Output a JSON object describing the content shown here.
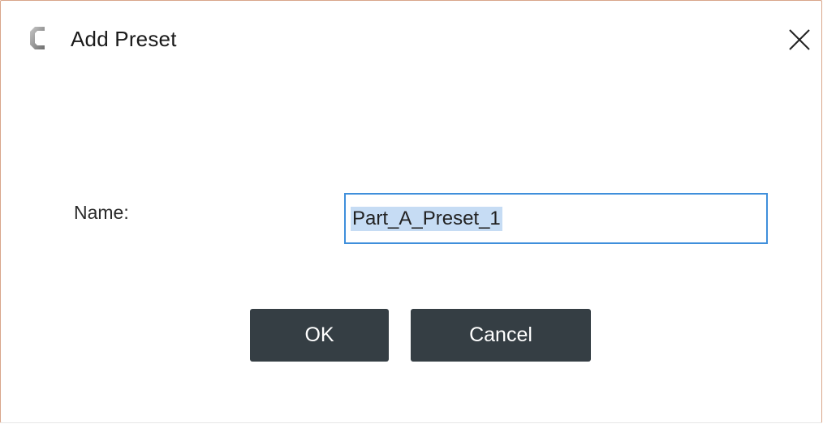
{
  "dialog": {
    "title": "Add Preset",
    "app_icon": "crescent-logo-icon",
    "close_icon": "close-icon"
  },
  "form": {
    "name_label": "Name:",
    "name_value": "Part_A_Preset_1",
    "name_selected": true
  },
  "buttons": {
    "ok_label": "OK",
    "cancel_label": "Cancel"
  },
  "colors": {
    "button_bg": "#353e44",
    "input_focus_border": "#3f8fdb",
    "selection_highlight": "#c6dcf4",
    "window_border": "#d9a68a"
  }
}
